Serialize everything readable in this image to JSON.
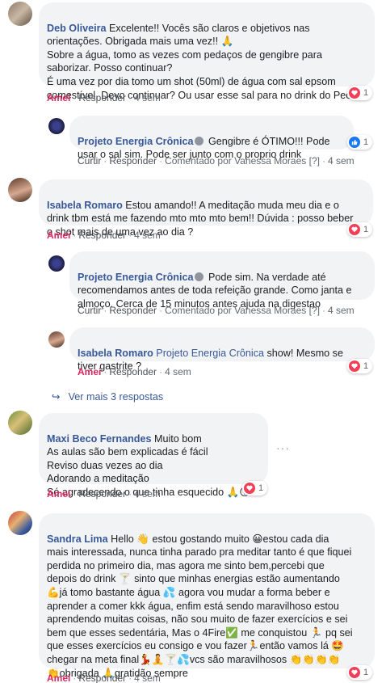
{
  "labels": {
    "love": "Amei",
    "reply": "Responder",
    "like": "Curtir",
    "dot": "·",
    "more_replies": "Ver mais 3 respostas"
  },
  "colors": {
    "link": "#385898",
    "love": "#e0245e",
    "bubble": "#f2f3f5"
  },
  "comments": [
    {
      "author": "Deb Oliveira",
      "text": " Excelente!! Vocês são claros e objetivos nas\norientações. Obrigada mais uma vez!! 🙏\nSobre a água, tomo as vezes com pedaços de gengibre para\nsaborizar. Posso continuar?\nÉ uma vez por dia tomo um shot (50ml) de água com sal epsom\ncomestível. Devo continuar? Ou usar esse sal para no drink do Pec?",
      "time": "4 sem",
      "reaction_count": "1"
    },
    {
      "author": "Projeto Energia Crônica",
      "text": " Gengibre é ÓTIMO!!! Pode\nusar o sal sim. Pode ser junto com o proprio drink",
      "time": "4 sem",
      "commented_by": "Comentado por Vanessa Moraes [?]",
      "reaction_count": "1"
    },
    {
      "author": "Isabela Romaro",
      "text": " Estou amando!! A meditação muda meu dia e o\ndrink tbm está me fazendo mto mto mto bem!! Dúvida : posso beber\no shot mais de uma vez ao dia ?",
      "time": "4 sem",
      "reaction_count": "1"
    },
    {
      "author": "Projeto Energia Crônica",
      "text": " Pode sim. Na verdade até\nrecomendamos antes de toda refeição grande. Como janta e\nalmoço. Cerca de 15 minutos antes ajuda na digestao",
      "time": "4 sem",
      "commented_by": "Comentado por Vanessa Moraes [?]"
    },
    {
      "author": "Isabela Romaro",
      "mention": " Projeto Energia Crônica",
      "text": " show! Mesmo se\ntiver gastrite ?",
      "time": "4 sem",
      "reaction_count": "1"
    },
    {
      "author": "Maxi Beco Fernandes",
      "text": " Muito bom\nAs aulas são bem explicadas é fácil\nReviso duas vezes ao dia\nAdorando a meditação\nSó agradecendo o que tinha esquecido 🙏😘",
      "time": "4 sem",
      "reaction_count": "1",
      "more": "···"
    },
    {
      "author": "Sandra Lima",
      "text": " Hello 👋 estou gostando muito 😀estou cada dia\nmais interessada, nunca tinha parado pra meditar tanto é que fiquei\nperdida no primeiro dia, mas agora me sinto bem,percebi que\ndepois do drink 🍸 sinto que minhas energias estão aumentando\n💪já tomo bastante água 💦 agora vou mudar a forma beber e\naprender a comer kkk água, enfim está sendo maravilhoso estou\naprendendo muitas coisas, não sou muito de fazer exercícios e sei\nbem que esses sedentária, Mas o 4Fire✅ me conquistou 🏃 pq sei\nque esses exercícios eu consigo e vou fazer🏃então vamos lá 🤩\nchegar na meta final💃🧘🍸💦vcs são maravilhosos 👏👏👏👏\n👏obrigada 🙏gratidão sempre",
      "time": "4 sem",
      "reaction_count": "1"
    }
  ]
}
